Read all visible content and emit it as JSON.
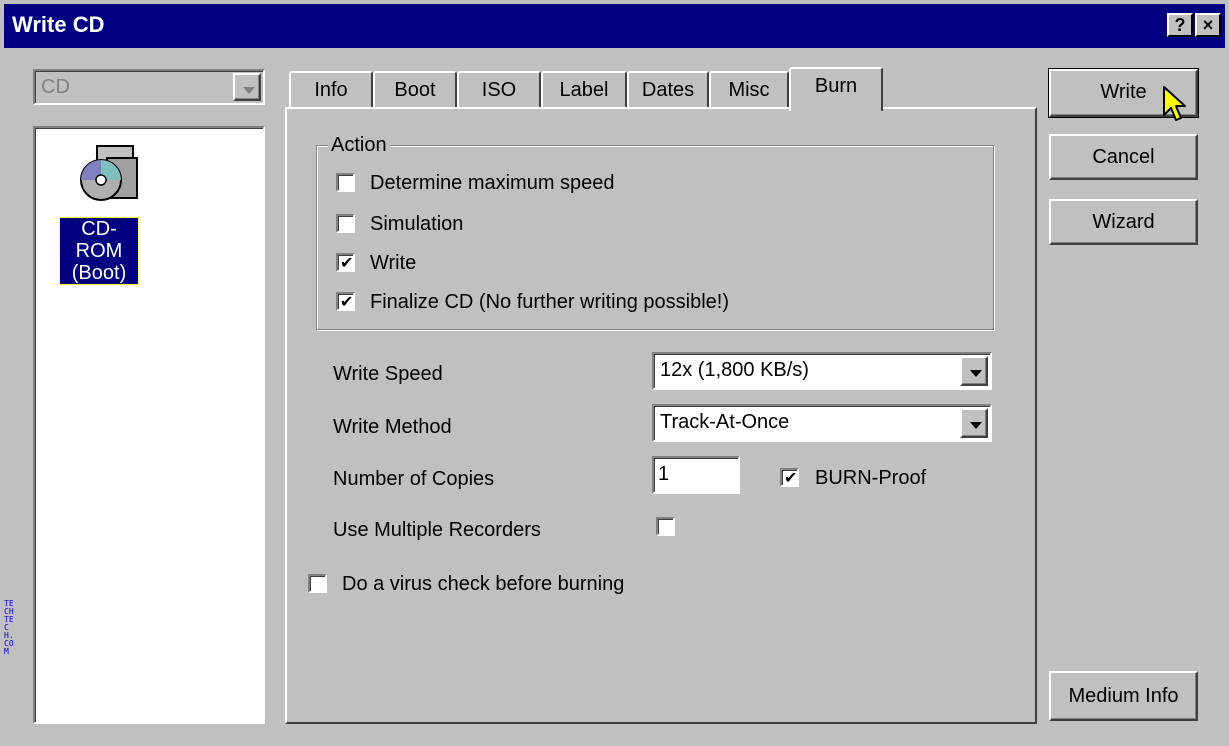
{
  "window": {
    "title": "Write CD",
    "help_button": "?",
    "close_button": "×"
  },
  "drive_selector": {
    "value": "CD"
  },
  "device_list": {
    "items": [
      {
        "label_line1": "CD-ROM",
        "label_line2": "(Boot)",
        "icon": "cd-rom-icon",
        "selected": true
      }
    ]
  },
  "tabs": [
    {
      "label": "Info"
    },
    {
      "label": "Boot"
    },
    {
      "label": "ISO"
    },
    {
      "label": "Label"
    },
    {
      "label": "Dates"
    },
    {
      "label": "Misc"
    },
    {
      "label": "Burn",
      "active": true
    }
  ],
  "action_group": {
    "title": "Action",
    "options": [
      {
        "label": "Determine maximum speed",
        "checked": false
      },
      {
        "label": "Simulation",
        "checked": false
      },
      {
        "label": "Write",
        "checked": true
      },
      {
        "label": "Finalize CD (No further writing possible!)",
        "checked": true
      }
    ]
  },
  "settings": {
    "write_speed_label": "Write Speed",
    "write_speed_value": "12x (1,800 KB/s)",
    "write_method_label": "Write Method",
    "write_method_value": "Track-At-Once",
    "copies_label": "Number of Copies",
    "copies_value": "1",
    "burn_proof_label": "BURN-Proof",
    "burn_proof_checked": true,
    "multi_recorders_label": "Use Multiple Recorders",
    "multi_recorders_checked": false,
    "virus_check_label": "Do a virus check before burning",
    "virus_check_checked": false
  },
  "buttons": {
    "write": "Write",
    "cancel": "Cancel",
    "wizard": "Wizard",
    "medium_info": "Medium Info"
  },
  "watermark": "TECHTECH.COM",
  "colors": {
    "title_bar": "#000080",
    "face": "#c0c0c0",
    "selection": "#000080"
  }
}
